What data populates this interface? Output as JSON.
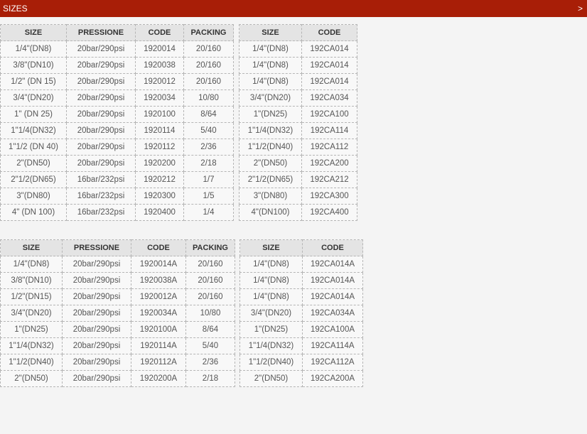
{
  "header": {
    "title": "SIZES",
    "arrow": ">"
  },
  "tables": {
    "t1": {
      "columns": [
        "SIZE",
        "PRESSIONE",
        "CODE",
        "PACKING"
      ],
      "rows": [
        [
          "1/4\"(DN8)",
          "20bar/290psi",
          "1920014",
          "20/160"
        ],
        [
          "3/8\"(DN10)",
          "20bar/290psi",
          "1920038",
          "20/160"
        ],
        [
          "1/2\" (DN 15)",
          "20bar/290psi",
          "1920012",
          "20/160"
        ],
        [
          "3/4\"(DN20)",
          "20bar/290psi",
          "1920034",
          "10/80"
        ],
        [
          "1\" (DN 25)",
          "20bar/290psi",
          "1920100",
          "8/64"
        ],
        [
          "1\"1/4(DN32)",
          "20bar/290psi",
          "1920114",
          "5/40"
        ],
        [
          "1\"1/2 (DN 40)",
          "20bar/290psi",
          "1920112",
          "2/36"
        ],
        [
          "2\"(DN50)",
          "20bar/290psi",
          "1920200",
          "2/18"
        ],
        [
          "2\"1/2(DN65)",
          "16bar/232psi",
          "1920212",
          "1/7"
        ],
        [
          "3\"(DN80)",
          "16bar/232psi",
          "1920300",
          "1/5"
        ],
        [
          "4\" (DN 100)",
          "16bar/232psi",
          "1920400",
          "1/4"
        ]
      ]
    },
    "t2": {
      "columns": [
        "SIZE",
        "CODE"
      ],
      "rows": [
        [
          "1/4\"(DN8)",
          "192CA014"
        ],
        [
          "1/4\"(DN8)",
          "192CA014"
        ],
        [
          "1/4\"(DN8)",
          "192CA014"
        ],
        [
          "3/4\"(DN20)",
          "192CA034"
        ],
        [
          "1\"(DN25)",
          "192CA100"
        ],
        [
          "1\"1/4(DN32)",
          "192CA114"
        ],
        [
          "1\"1/2(DN40)",
          "192CA112"
        ],
        [
          "2\"(DN50)",
          "192CA200"
        ],
        [
          "2\"1/2(DN65)",
          "192CA212"
        ],
        [
          "3\"(DN80)",
          "192CA300"
        ],
        [
          "4\"(DN100)",
          "192CA400"
        ]
      ]
    },
    "t3": {
      "columns": [
        "SIZE",
        "PRESSIONE",
        "CODE",
        "PACKING"
      ],
      "rows": [
        [
          "1/4\"(DN8)",
          "20bar/290psi",
          "1920014A",
          "20/160"
        ],
        [
          "3/8\"(DN10)",
          "20bar/290psi",
          "1920038A",
          "20/160"
        ],
        [
          "1/2\"(DN15)",
          "20bar/290psi",
          "1920012A",
          "20/160"
        ],
        [
          "3/4\"(DN20)",
          "20bar/290psi",
          "1920034A",
          "10/80"
        ],
        [
          "1\"(DN25)",
          "20bar/290psi",
          "1920100A",
          "8/64"
        ],
        [
          "1\"1/4(DN32)",
          "20bar/290psi",
          "1920114A",
          "5/40"
        ],
        [
          "1\"1/2(DN40)",
          "20bar/290psi",
          "1920112A",
          "2/36"
        ],
        [
          "2\"(DN50)",
          "20bar/290psi",
          "1920200A",
          "2/18"
        ]
      ]
    },
    "t4": {
      "columns": [
        "SIZE",
        "CODE"
      ],
      "rows": [
        [
          "1/4\"(DN8)",
          "192CA014A"
        ],
        [
          "1/4\"(DN8)",
          "192CA014A"
        ],
        [
          "1/4\"(DN8)",
          "192CA014A"
        ],
        [
          "3/4\"(DN20)",
          "192CA034A"
        ],
        [
          "1\"(DN25)",
          "192CA100A"
        ],
        [
          "1\"1/4(DN32)",
          "192CA114A"
        ],
        [
          "1\"1/2(DN40)",
          "192CA112A"
        ],
        [
          "2\"(DN50)",
          "192CA200A"
        ]
      ]
    }
  }
}
